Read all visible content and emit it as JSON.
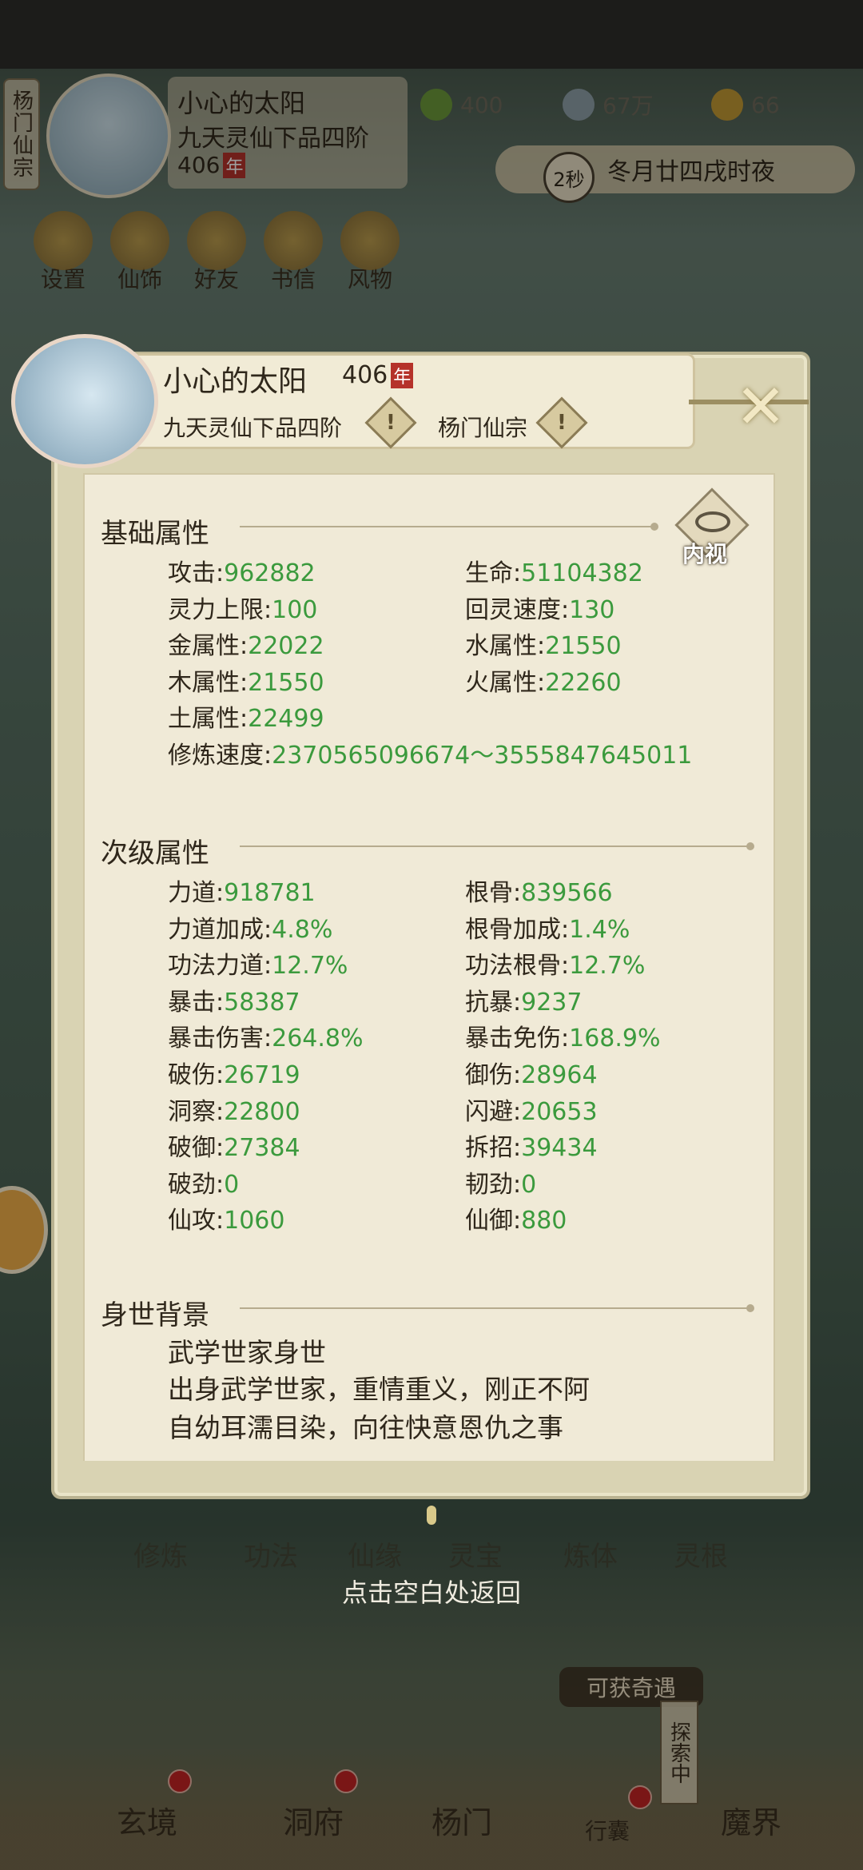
{
  "hud": {
    "sect_tab": "杨门仙宗",
    "player_name": "小心的太阳",
    "player_rank": "九天灵仙下品四阶",
    "player_age": "406",
    "age_unit": "年",
    "currency": [
      {
        "icon": "spirit-leaf-icon",
        "value": "400"
      },
      {
        "icon": "coin-icon",
        "value": "67万"
      },
      {
        "icon": "muscle-icon",
        "value": "66"
      }
    ],
    "time_badge": "2秒",
    "time_text": "冬月廿四戌时夜",
    "buttons": [
      "设置",
      "仙饰",
      "好友",
      "书信",
      "风物"
    ]
  },
  "profile": {
    "name": "小心的太阳",
    "age": "406",
    "age_unit": "年",
    "rank": "九天灵仙下品四阶",
    "sect": "杨门仙宗",
    "warn_glyph": "!",
    "inner_view_label": "内视"
  },
  "sections": {
    "basic_title": "基础属性",
    "secondary_title": "次级属性",
    "background_title": "身世背景"
  },
  "basic_attrs": [
    {
      "k": "攻击",
      "v": "962882"
    },
    {
      "k": "生命",
      "v": "51104382"
    },
    {
      "k": "灵力上限",
      "v": "100"
    },
    {
      "k": "回灵速度",
      "v": "130"
    },
    {
      "k": "金属性",
      "v": "22022"
    },
    {
      "k": "水属性",
      "v": "21550"
    },
    {
      "k": "木属性",
      "v": "21550"
    },
    {
      "k": "火属性",
      "v": "22260"
    },
    {
      "k": "土属性",
      "v": "22499"
    },
    {
      "k": "修炼速度",
      "v": "2370565096674～3555847645011"
    }
  ],
  "secondary_attrs": [
    {
      "k": "力道",
      "v": "918781"
    },
    {
      "k": "根骨",
      "v": "839566"
    },
    {
      "k": "力道加成",
      "v": "4.8%"
    },
    {
      "k": "根骨加成",
      "v": "1.4%"
    },
    {
      "k": "功法力道",
      "v": "12.7%"
    },
    {
      "k": "功法根骨",
      "v": "12.7%"
    },
    {
      "k": "暴击",
      "v": "58387"
    },
    {
      "k": "抗暴",
      "v": "9237"
    },
    {
      "k": "暴击伤害",
      "v": "264.8%"
    },
    {
      "k": "暴击免伤",
      "v": "168.9%"
    },
    {
      "k": "破伤",
      "v": "26719"
    },
    {
      "k": "御伤",
      "v": "28964"
    },
    {
      "k": "洞察",
      "v": "22800"
    },
    {
      "k": "闪避",
      "v": "20653"
    },
    {
      "k": "破御",
      "v": "27384"
    },
    {
      "k": "拆招",
      "v": "39434"
    },
    {
      "k": "破劲",
      "v": "0"
    },
    {
      "k": "韧劲",
      "v": "0"
    },
    {
      "k": "仙攻",
      "v": "1060"
    },
    {
      "k": "仙御",
      "v": "880"
    }
  ],
  "background": {
    "title": "武学世家身世",
    "lines": [
      "出身武学世家，重情重义，刚正不阿",
      "自幼耳濡目染，向往快意恩仇之事"
    ]
  },
  "hint": "点击空白处返回",
  "behind_row": [
    "修炼",
    "功法",
    "仙缘",
    "灵宝",
    "炼体",
    "灵根"
  ],
  "qiyu": "可获奇遇",
  "explore": "探索中",
  "bottom_nav": [
    {
      "label": "玄境",
      "dot": true
    },
    {
      "label": "洞府",
      "dot": true
    },
    {
      "label": "杨门",
      "dot": false
    },
    {
      "label": "行囊",
      "dot": true
    },
    {
      "label": "魔界",
      "dot": false
    }
  ],
  "colors": {
    "value_green": "#3b9a3d",
    "badge_red": "#b5322a",
    "panel": "#f0ead7"
  }
}
